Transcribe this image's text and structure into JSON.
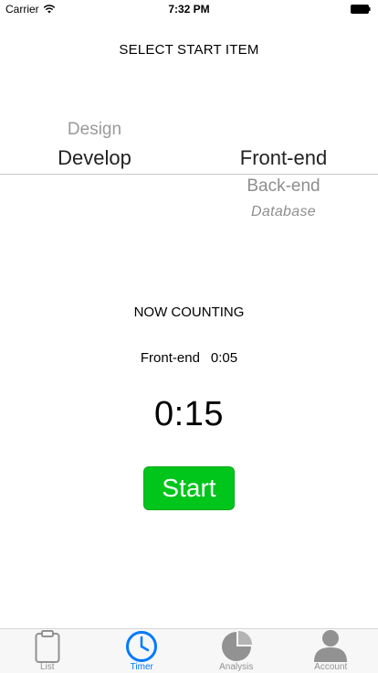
{
  "status_bar": {
    "carrier": "Carrier",
    "time": "7:32 PM",
    "icons": [
      "wifi-icon",
      "battery-icon"
    ]
  },
  "select_title": "SELECT START ITEM",
  "picker": {
    "left": {
      "above": "Design",
      "selected": "Develop"
    },
    "right": {
      "selected": "Front-end",
      "below1": "Back-end",
      "below2": "Database"
    }
  },
  "counting_title": "NOW COUNTING",
  "current": {
    "item": "Front-end",
    "time": "0:05"
  },
  "timer": "0:15",
  "start_button": "Start",
  "colors": {
    "accent": "#007aff",
    "start_green": "#00c51b",
    "tab_inactive": "#929292"
  },
  "tabs": [
    {
      "label": "List",
      "icon": "clipboard-icon"
    },
    {
      "label": "Timer",
      "icon": "clock-icon",
      "active": true
    },
    {
      "label": "Analysis",
      "icon": "pie-chart-icon"
    },
    {
      "label": "Account",
      "icon": "person-icon"
    }
  ]
}
